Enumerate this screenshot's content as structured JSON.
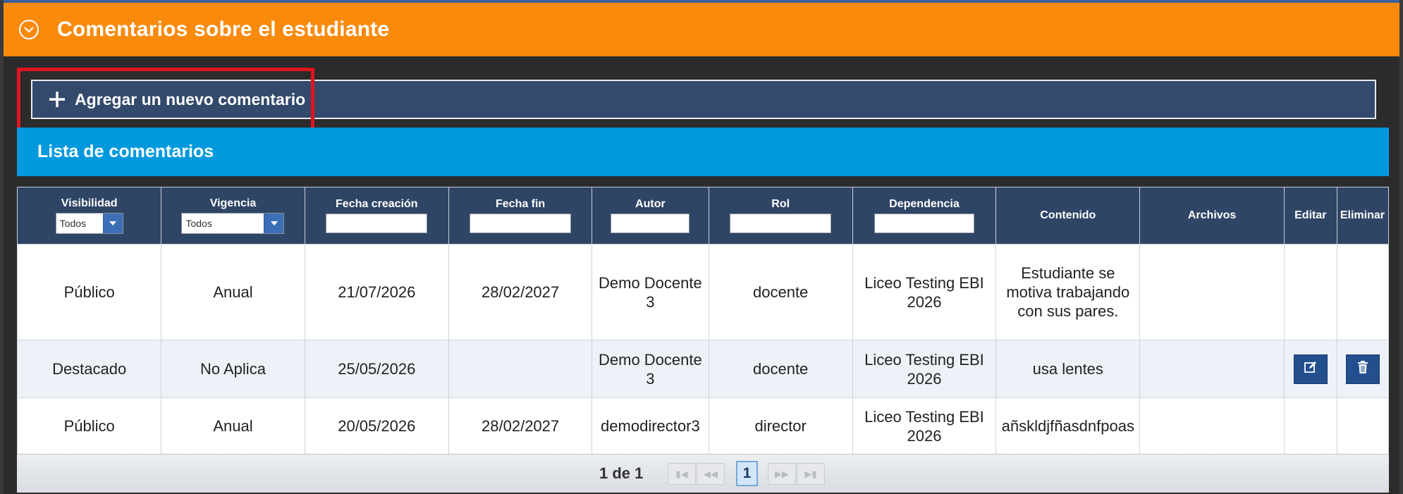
{
  "section": {
    "title": "Comentarios sobre el estudiante",
    "toggle_icon": "chevron-circle-icon"
  },
  "add_comment": {
    "label": "Agregar un nuevo comentario",
    "icon": "plus-icon"
  },
  "list": {
    "title": "Lista de comentarios"
  },
  "table": {
    "columns": {
      "visibilidad": "Visibilidad",
      "vigencia": "Vigencia",
      "fecha_creacion": "Fecha creación",
      "fecha_fin": "Fecha fin",
      "autor": "Autor",
      "rol": "Rol",
      "dependencia": "Dependencia",
      "contenido": "Contenido",
      "archivos": "Archivos",
      "editar": "Editar",
      "eliminar": "Eliminar"
    },
    "filters": {
      "visibilidad_selected": "Todos",
      "vigencia_selected": "Todos",
      "fecha_creacion": "",
      "fecha_fin": "",
      "autor": "",
      "rol": "",
      "dependencia": ""
    },
    "rows": [
      {
        "visibilidad": "Público",
        "vigencia": "Anual",
        "fecha_creacion": "21/07/2026",
        "fecha_fin": "28/02/2027",
        "autor": "Demo Docente 3",
        "rol": "docente",
        "dependencia": "Liceo Testing EBI 2026",
        "contenido": "Estudiante se motiva trabajando con sus pares.",
        "archivos": ""
      },
      {
        "visibilidad": "Destacado",
        "vigencia": "No Aplica",
        "fecha_creacion": "25/05/2026",
        "fecha_fin": "",
        "autor": "Demo Docente 3",
        "rol": "docente",
        "dependencia": "Liceo Testing EBI 2026",
        "contenido": "usa lentes",
        "archivos": ""
      },
      {
        "visibilidad": "Público",
        "vigencia": "Anual",
        "fecha_creacion": "20/05/2026",
        "fecha_fin": "28/02/2027",
        "autor": "demodirector3",
        "rol": "director",
        "dependencia": "Liceo Testing EBI 2026",
        "contenido": "añskldjfñasdnfpoas",
        "archivos": ""
      }
    ]
  },
  "pager": {
    "info": "1 de 1",
    "current_page": "1"
  },
  "colors": {
    "header_orange": "#f98a0c",
    "add_bar": "#334a6c",
    "list_header_blue": "#0099dd",
    "table_header": "#2f4566",
    "highlight_red": "#e0141f",
    "action_button": "#244f8e"
  }
}
